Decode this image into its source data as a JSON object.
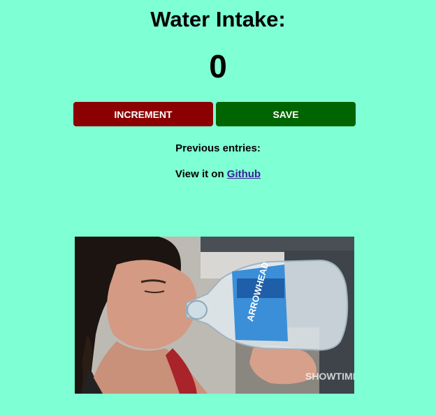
{
  "page": {
    "title": "Water Intake:",
    "count": "0",
    "buttons": {
      "increment_label": "Increment",
      "save_label": "Save"
    },
    "previous_entries_label": "Previous entries:",
    "github": {
      "prefix": "View it on ",
      "link_label": "Github"
    },
    "gif": {
      "bottle_label": "ARROWHEAD",
      "watermark": "SHOWTIME"
    }
  },
  "colors": {
    "background": "#7fffd4",
    "increment_button": "#8b0000",
    "save_button": "#006400",
    "link": "#3a1f99"
  }
}
